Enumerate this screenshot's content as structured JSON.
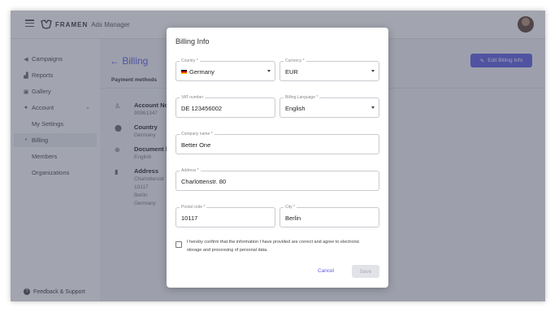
{
  "app": {
    "brand": "FRAMEN",
    "product": "Ads Manager"
  },
  "sidebar": {
    "items": [
      {
        "label": "Campaigns",
        "icon": "megaphone-icon"
      },
      {
        "label": "Reports",
        "icon": "bar-chart-icon"
      },
      {
        "label": "Gallery",
        "icon": "gallery-icon"
      },
      {
        "label": "Account",
        "icon": "account-circle-icon"
      },
      {
        "label": "My Settings"
      },
      {
        "label": "Billing",
        "active": true
      },
      {
        "label": "Members"
      },
      {
        "label": "Organizations"
      }
    ],
    "feedback": "Feedback & Support"
  },
  "main": {
    "title": "Billing",
    "tab": "Payment methods",
    "edit_button": "Edit Billing Info",
    "account_no_label": "Account No.",
    "account_no_value": "90961347",
    "country_label": "Country",
    "country_value": "Germany",
    "doc_lang_label": "Document lang",
    "doc_lang_value": "English",
    "address_label": "Address",
    "address_lines": [
      "Charlottenstr",
      "10117",
      "Berlin",
      "Germany"
    ]
  },
  "modal": {
    "title": "Billing Info",
    "country": {
      "label": "Country *",
      "value": "Germany"
    },
    "currency": {
      "label": "Currency *",
      "value": "EUR"
    },
    "vat": {
      "label": "VAT number",
      "value": "DE 123456002"
    },
    "billing_language": {
      "label": "Billing Language *",
      "value": "English"
    },
    "company": {
      "label": "Company name *",
      "value": "Better One"
    },
    "address": {
      "label": "Address *",
      "value": "Charlottenstr. 80"
    },
    "postal": {
      "label": "Postal code *",
      "value": "10117"
    },
    "city": {
      "label": "City *",
      "value": "Berlin"
    },
    "consent_line1": "I hereby confirm that the information I have provided are correct and agree to electronic",
    "consent_line2": "storage and processing of personal data.",
    "cancel": "Cancel",
    "save": "Save"
  },
  "colors": {
    "accent": "#5b5ce2",
    "overlay": "#464a5f"
  }
}
